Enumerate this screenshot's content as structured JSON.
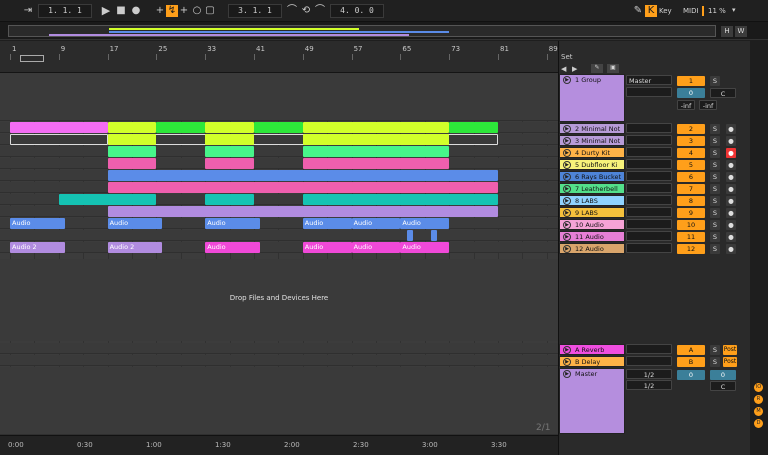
{
  "transport": {
    "position": "1. 1. 1",
    "loop_start": "3. 1. 1",
    "loop_length": "4. 0. 0",
    "key_label": "Key",
    "midi_label": "MIDI",
    "cpu": "11 %"
  },
  "overview": {
    "h_label": "H",
    "w_label": "W"
  },
  "ruler": {
    "bars": [
      "1",
      "9",
      "17",
      "25",
      "33",
      "41",
      "49",
      "57",
      "65",
      "73",
      "81",
      "89"
    ]
  },
  "set_label": "Set",
  "drop_text": "Drop Files and Devices Here",
  "fraction_label": "2/1",
  "time_labels": [
    "0:00",
    "0:30",
    "1:00",
    "1:30",
    "2:00",
    "2:30",
    "3:00",
    "3:30"
  ],
  "colors": {
    "orange": "#ff9f1a",
    "magenta": "#f36cf3",
    "lime": "#d2ff2a",
    "green": "#2de83a",
    "pink": "#ef5fae",
    "blue": "#5b8ce8",
    "teal": "#15c3b3",
    "lavender": "#b18ce0",
    "hotpink": "#f049d8",
    "group": "#b58ede"
  },
  "tracks": [
    {
      "name": "1 Group",
      "num": "1",
      "color": "#b58ede",
      "out": "Master"
    },
    {
      "name": "2 Minimal Not",
      "num": "2",
      "color": "#b79bd8"
    },
    {
      "name": "3 Minimal Not",
      "num": "3",
      "color": "#b79bd8"
    },
    {
      "name": "4 Durty Kit",
      "num": "4",
      "color": "#ffb347"
    },
    {
      "name": "5 Dubfloor Ki",
      "num": "5",
      "color": "#f7f27a"
    },
    {
      "name": "6 Rays Bucket",
      "num": "6",
      "color": "#4e84d8"
    },
    {
      "name": "7 Leatherbell",
      "num": "7",
      "color": "#53e08a"
    },
    {
      "name": "8 LABS",
      "num": "8",
      "color": "#8fd3ff"
    },
    {
      "name": "9 LABS",
      "num": "9",
      "color": "#f5c13c"
    },
    {
      "name": "10 Audio",
      "num": "10",
      "color": "#f6a3d6"
    },
    {
      "name": "11 Audio",
      "num": "11",
      "color": "#e67fd6"
    },
    {
      "name": "12 Audio",
      "num": "12",
      "color": "#d9a56b"
    }
  ],
  "group_controls": {
    "vol": "0",
    "pan": "C",
    "inf_left": "-inf",
    "inf_right": "-inf"
  },
  "returns": [
    {
      "name": "A Reverb",
      "letter": "A",
      "post": "Post",
      "color": "#f04ee0"
    },
    {
      "name": "B Delay",
      "letter": "B",
      "post": "Post",
      "color": "#ffb347"
    }
  ],
  "master": {
    "name": "Master",
    "color": "#b58ede",
    "sel1": "1/2",
    "sel2": "1/2",
    "vol": "0",
    "vol2": "0",
    "pan": "C"
  },
  "clip_labels": {
    "audio": "Audio",
    "audio2": "Audio 2"
  }
}
